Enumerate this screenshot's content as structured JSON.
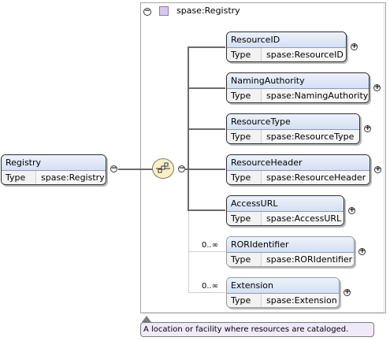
{
  "root": {
    "name": "Registry",
    "type_key": "Type",
    "type_value": "spase:Registry",
    "annotation": "A location or facility where resources are cataloged."
  },
  "group": {
    "title": "spase:Registry",
    "collapse_glyph": "⊖",
    "compositor": "sequence"
  },
  "children": [
    {
      "name": "ResourceID",
      "type_key": "Type",
      "type_value": "spase:ResourceID",
      "occurrence": ""
    },
    {
      "name": "NamingAuthority",
      "type_key": "Type",
      "type_value": "spase:NamingAuthority",
      "occurrence": ""
    },
    {
      "name": "ResourceType",
      "type_key": "Type",
      "type_value": "spase:ResourceType",
      "occurrence": ""
    },
    {
      "name": "ResourceHeader",
      "type_key": "Type",
      "type_value": "spase:ResourceHeader",
      "occurrence": ""
    },
    {
      "name": "AccessURL",
      "type_key": "Type",
      "type_value": "spase:AccessURL",
      "occurrence": ""
    },
    {
      "name": "RORIdentifier",
      "type_key": "Type",
      "type_value": "spase:RORIdentifier",
      "occurrence": "0..∞"
    },
    {
      "name": "Extension",
      "type_key": "Type",
      "type_value": "spase:Extension",
      "occurrence": "0..∞"
    }
  ],
  "expand_glyph": "+",
  "collapse_small_glyph": "−"
}
